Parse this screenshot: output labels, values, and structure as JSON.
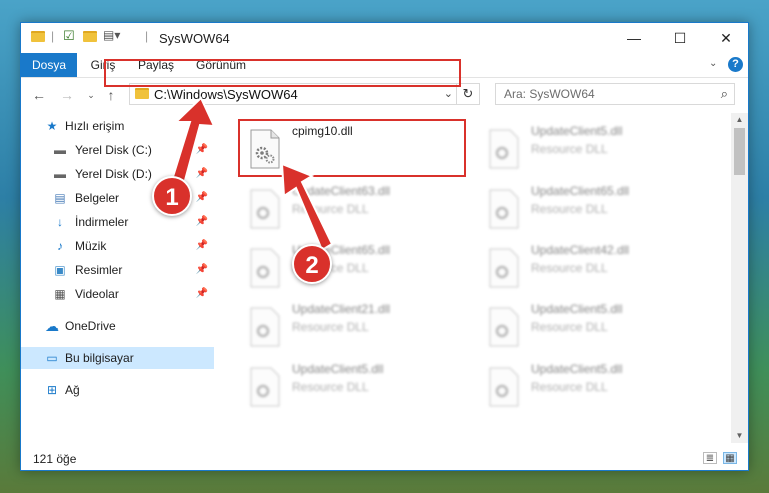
{
  "window": {
    "title": "SysWOW64",
    "controls": {
      "minimize": "—",
      "maximize": "☐",
      "close": "✕"
    }
  },
  "ribbon": {
    "tabs": [
      {
        "label": "Dosya"
      },
      {
        "label": "Giriş"
      },
      {
        "label": "Paylaş"
      },
      {
        "label": "Görünüm"
      }
    ],
    "help": "?"
  },
  "address": {
    "path": "C:\\Windows\\SysWOW64",
    "search_placeholder": "Ara: SysWOW64"
  },
  "nav": {
    "items": [
      {
        "label": "Hızlı erişim",
        "icon": "star-icon",
        "glyph": "★",
        "pinned": false
      },
      {
        "label": "Yerel Disk (C:)",
        "icon": "drive-icon",
        "glyph": "▬",
        "pinned": true
      },
      {
        "label": "Yerel Disk (D:)",
        "icon": "drive-icon",
        "glyph": "▬",
        "pinned": true
      },
      {
        "label": "Belgeler",
        "icon": "documents-icon",
        "glyph": "▤",
        "pinned": true
      },
      {
        "label": "İndirmeler",
        "icon": "download-icon",
        "glyph": "↓",
        "pinned": true
      },
      {
        "label": "Müzik",
        "icon": "music-icon",
        "glyph": "♪",
        "pinned": true
      },
      {
        "label": "Resimler",
        "icon": "pictures-icon",
        "glyph": "▣",
        "pinned": true
      },
      {
        "label": "Videolar",
        "icon": "video-icon",
        "glyph": "▦",
        "pinned": true
      },
      {
        "label": "OneDrive",
        "icon": "cloud-icon",
        "glyph": "☁",
        "pinned": false
      },
      {
        "label": "Bu bilgisayar",
        "icon": "computer-icon",
        "glyph": "▭",
        "pinned": false,
        "selected": true
      },
      {
        "label": "Ağ",
        "icon": "network-icon",
        "glyph": "⊞",
        "pinned": false
      }
    ]
  },
  "files": [
    {
      "name": "cpimg10.dll",
      "type": "",
      "highlighted": true
    },
    {
      "name": "UpdateClient5.dll",
      "type": "Resource DLL"
    },
    {
      "name": "UpdateClient63.dll",
      "type": "Resource DLL"
    },
    {
      "name": "UpdateClient65.dll",
      "type": "Resource DLL"
    },
    {
      "name": "UpdateClient65.dll",
      "type": "Resource DLL"
    },
    {
      "name": "UpdateClient42.dll",
      "type": "Resource DLL"
    },
    {
      "name": "UpdateClient21.dll",
      "type": "Resource DLL"
    },
    {
      "name": "UpdateClient5.dll",
      "type": "Resource DLL"
    },
    {
      "name": "UpdateClient5.dll",
      "type": "Resource DLL"
    },
    {
      "name": "UpdateClient5.dll",
      "type": "Resource DLL"
    }
  ],
  "status": {
    "count": "121 öğe"
  },
  "callouts": {
    "one": "1",
    "two": "2"
  },
  "colors": {
    "accent": "#1979ca",
    "highlight": "#d9312b",
    "selection": "#cce8ff"
  }
}
